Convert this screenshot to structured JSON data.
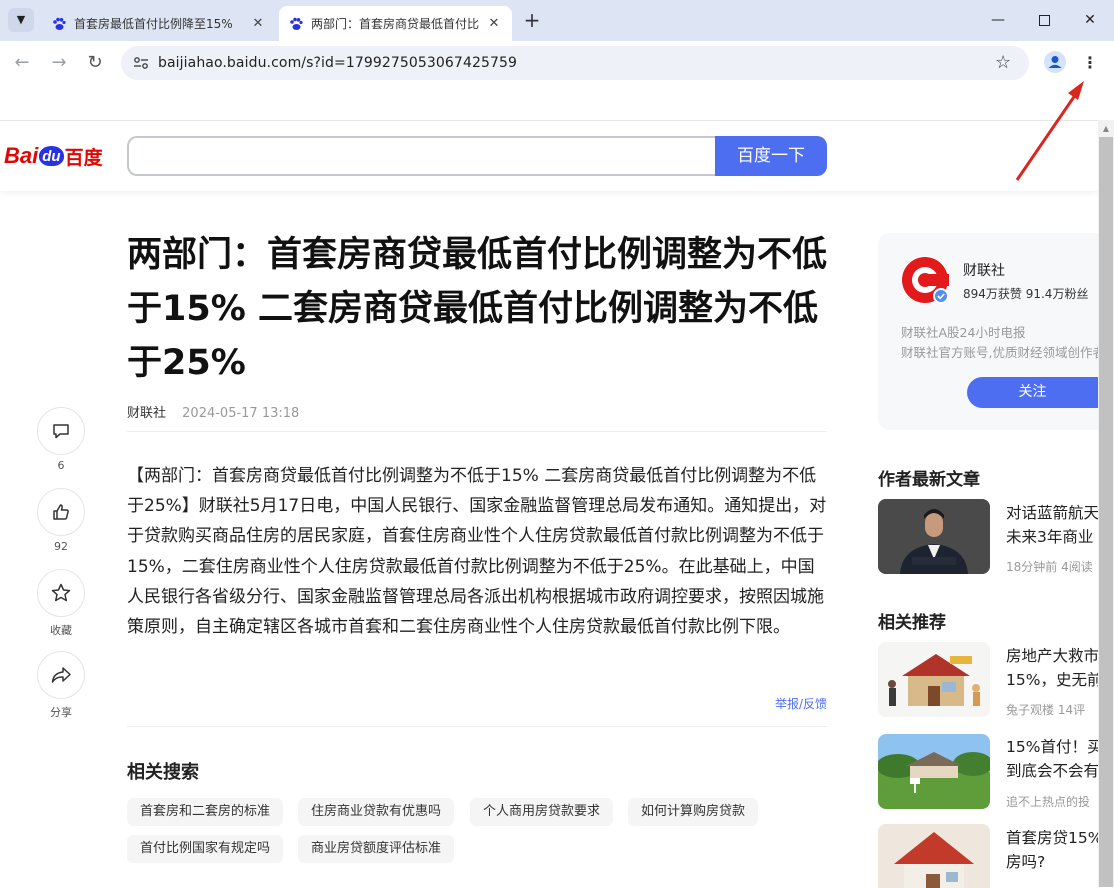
{
  "browser": {
    "tabs": [
      {
        "title": "首套房最低首付比例降至15%",
        "active": false
      },
      {
        "title": "两部门：首套房商贷最低首付比",
        "active": true
      }
    ],
    "new_tab_symbol": "+",
    "url": "baijiahao.baidu.com/s?id=1799275053067425759"
  },
  "site": {
    "logo_text_left": "Bai",
    "logo_text_du": "du",
    "logo_text_cn": "百度",
    "search_button": "百度一下",
    "search_value": ""
  },
  "article": {
    "headline": "两部门：首套房商贷最低首付比例调整为不低于15% 二套房商贷最低首付比例调整为不低于25%",
    "source": "财联社",
    "time": "2024-05-17 13:18",
    "body": "【两部门：首套房商贷最低首付比例调整为不低于15% 二套房商贷最低首付比例调整为不低于25%】财联社5月17日电，中国人民银行、国家金融监督管理总局发布通知。通知提出，对于贷款购买商品住房的居民家庭，首套住房商业性个人住房贷款最低首付款比例调整为不低于15%，二套住房商业性个人住房贷款最低首付款比例调整为不低于25%。在此基础上，中国人民银行各省级分行、国家金融监督管理总局各派出机构根据城市政府调控要求，按照因城施策原则，自主确定辖区各城市首套和二套住房商业性个人住房贷款最低首付款比例下限。",
    "report_link": "举报/反馈"
  },
  "actions": {
    "comment_count": "6",
    "like_count": "92",
    "favorite_label": "收藏",
    "share_label": "分享"
  },
  "related_search": {
    "heading": "相关搜索",
    "chips": [
      "首套房和二套房的标准",
      "住房商业贷款有优惠吗",
      "个人商用房贷款要求",
      "如何计算购房贷款",
      "首付比例国家有规定吗",
      "商业房贷额度评估标准"
    ]
  },
  "author": {
    "name": "财联社",
    "stats": "894万获赞 91.4万粉丝",
    "desc1": "财联社A股24小时电报",
    "desc2": "财联社官方账号,优质财经领域创作者",
    "follow_label": "关注"
  },
  "latest": {
    "heading": "作者最新文章",
    "items": [
      {
        "title1": "对话蓝箭航天",
        "title2": "未来3年商业",
        "meta": "18分钟前   4阅读"
      }
    ]
  },
  "recommend": {
    "heading": "相关推荐",
    "items": [
      {
        "title1": "房地产大救市",
        "title2": "15%，史无前",
        "meta": "兔子观楼   14评"
      },
      {
        "title1": "15%首付！买",
        "title2": "到底会不会有",
        "meta": "追不上热点的投"
      },
      {
        "title1": "首套房贷15%",
        "title2": "房吗?",
        "meta": ""
      }
    ]
  },
  "colors": {
    "accent": "#4e6ef2",
    "tabstrip": "#dde4f4",
    "omnibox": "#eef1f8",
    "annotation_arrow": "#d9271f"
  }
}
